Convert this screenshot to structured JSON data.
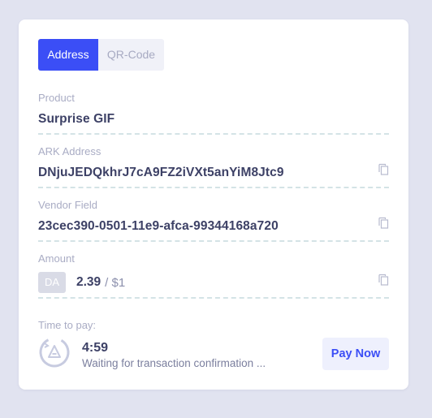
{
  "tabs": [
    {
      "label": "Address",
      "active": true
    },
    {
      "label": "QR-Code",
      "active": false
    }
  ],
  "product": {
    "label": "Product",
    "value": "Surprise GIF"
  },
  "address": {
    "label": "ARK Address",
    "value": "DNjuJEDQkhrJ7cA9FZ2iVXt5anYiM8Jtc9",
    "icon": "copy-icon"
  },
  "vendor": {
    "label": "Vendor Field",
    "value": "23cec390-0501-11e9-afca-99344168a720",
    "icon": "copy-icon"
  },
  "amount": {
    "label": "Amount",
    "currency": "DA",
    "value": "2.39",
    "fiat": "/ $1",
    "icon": "copy-icon"
  },
  "payment": {
    "time_label": "Time to pay:",
    "time_left": "4:59",
    "status": "Waiting for transaction confirmation ...",
    "timer_icon": "countdown-ark-icon",
    "pay_button": "Pay Now"
  },
  "colors": {
    "accent": "#3b4ef6",
    "background": "#e1e3f0",
    "text": "#3d4166"
  }
}
